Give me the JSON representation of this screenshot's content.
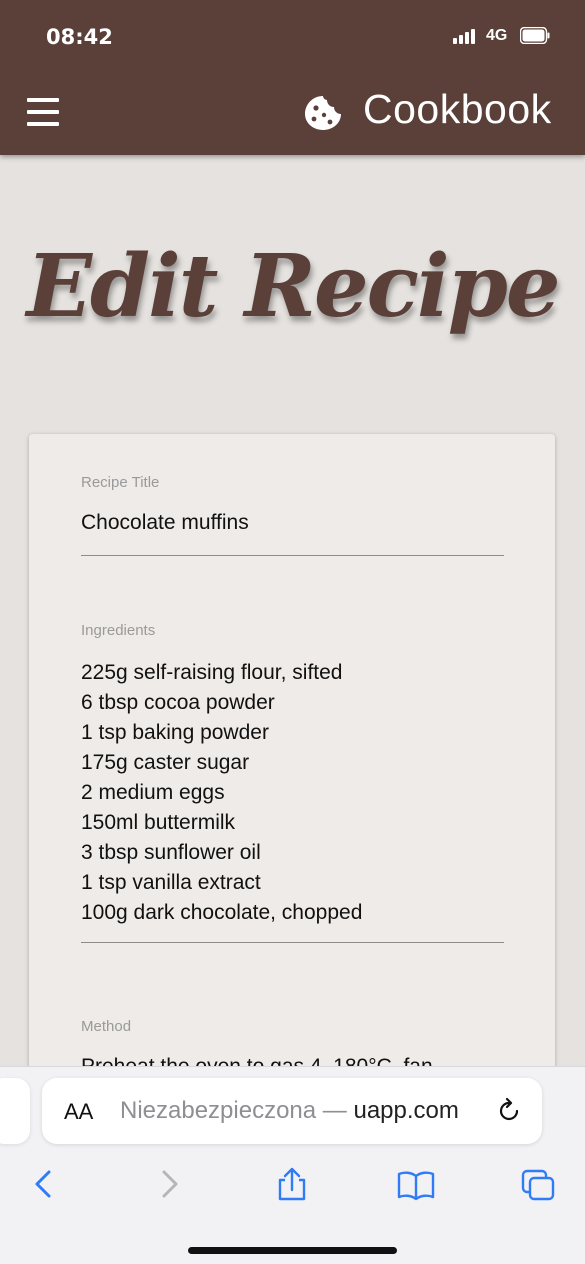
{
  "status_bar": {
    "time": "08:42",
    "network": "4G"
  },
  "app_bar": {
    "brand": "Cookbook"
  },
  "page_title": "Edit Recipe",
  "form": {
    "title_label": "Recipe Title",
    "title_value": "Chocolate muffins",
    "ingredients_label": "Ingredients",
    "ingredients": [
      "225g self-raising flour, sifted",
      "6 tbsp cocoa powder",
      "1 tsp baking powder",
      "175g caster sugar",
      "2 medium eggs",
      "150ml buttermilk",
      "3 tbsp sunflower oil",
      "1 tsp vanilla extract",
      "100g dark chocolate, chopped"
    ],
    "method_label": "Method",
    "method_value": "Preheat the oven to gas 4, 180°C, fan"
  },
  "browser": {
    "aa_label": "AA",
    "url_prefix": "Niezabezpieczona — ",
    "url_domain": "uapp.com"
  },
  "colors": {
    "brand_brown": "#5a4038",
    "background": "#e5e2df",
    "ios_blue": "#2f7cf6"
  }
}
